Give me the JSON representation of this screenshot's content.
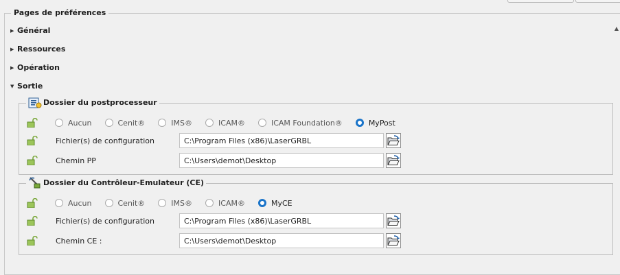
{
  "pages_title": "Pages de préférences",
  "tree": {
    "general": "Général",
    "resources": "Ressources",
    "operation": "Opération",
    "output": "Sortie"
  },
  "postprocessor": {
    "title": "Dossier du postprocesseur",
    "options": [
      "Aucun",
      "Cenit®",
      "IMS®",
      "ICAM®",
      "ICAM Foundation®",
      "MyPost"
    ],
    "selected": "MyPost",
    "config_label": "Fichier(s) de configuration",
    "config_value": "C:\\Program Files (x86)\\LaserGRBL",
    "path_label": "Chemin PP",
    "path_value": "C:\\Users\\demot\\Desktop"
  },
  "controller": {
    "title": "Dossier du Contrôleur-Emulateur (CE)",
    "options": [
      "Aucun",
      "Cenit®",
      "IMS®",
      "ICAM®",
      "MyCE"
    ],
    "selected": "MyCE",
    "config_label": "Fichier(s) de configuration",
    "config_value": "C:\\Program Files (x86)\\LaserGRBL",
    "path_label": "Chemin CE :",
    "path_value": "C:\\Users\\demot\\Desktop"
  },
  "colors": {
    "accent": "#1a74c9",
    "lock_green": "#7aa83a"
  },
  "icons": {
    "expand": "triangle-right-icon",
    "collapse": "triangle-down-icon",
    "lock": "unlocked-padlock-icon",
    "browse": "open-folder-icon"
  }
}
